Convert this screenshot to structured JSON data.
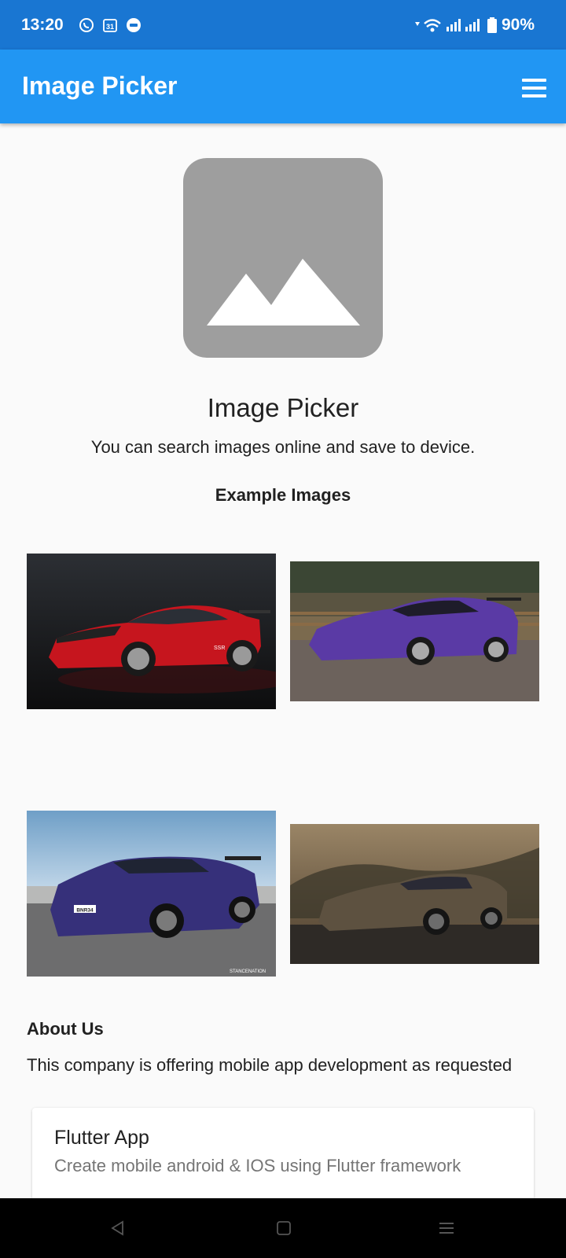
{
  "status_bar": {
    "time": "13:20",
    "battery": "90%",
    "icons": [
      "whatsapp-icon",
      "calendar-icon",
      "chat-icon",
      "wifi-icon",
      "signal-icon",
      "battery-icon"
    ],
    "calendar_day": "31"
  },
  "app_bar": {
    "title": "Image Picker",
    "menu_icon": "hamburger-menu-icon"
  },
  "hero": {
    "icon": "image-placeholder-icon",
    "title": "Image Picker",
    "subtitle": "You can search images online and save to device."
  },
  "examples": {
    "heading": "Example Images",
    "images": [
      {
        "name": "red-sports-car-photo",
        "caption": "SSR"
      },
      {
        "name": "purple-drift-car-photo"
      },
      {
        "name": "blue-skyline-car-photo",
        "plate": "BNR34",
        "watermark": "STANCENATION"
      },
      {
        "name": "tinted-drift-car-photo"
      }
    ]
  },
  "about": {
    "heading": "About Us",
    "text": "This company is offering mobile app development as requested"
  },
  "card": {
    "title": "Flutter App",
    "subtitle": "Create mobile android & IOS using Flutter framework"
  },
  "nav_bar": {
    "icons": [
      "back-icon",
      "home-icon",
      "recents-icon"
    ]
  },
  "colors": {
    "status_bar": "#1976d2",
    "app_bar": "#2196f3",
    "background": "#fafafa",
    "placeholder": "#9e9e9e"
  }
}
